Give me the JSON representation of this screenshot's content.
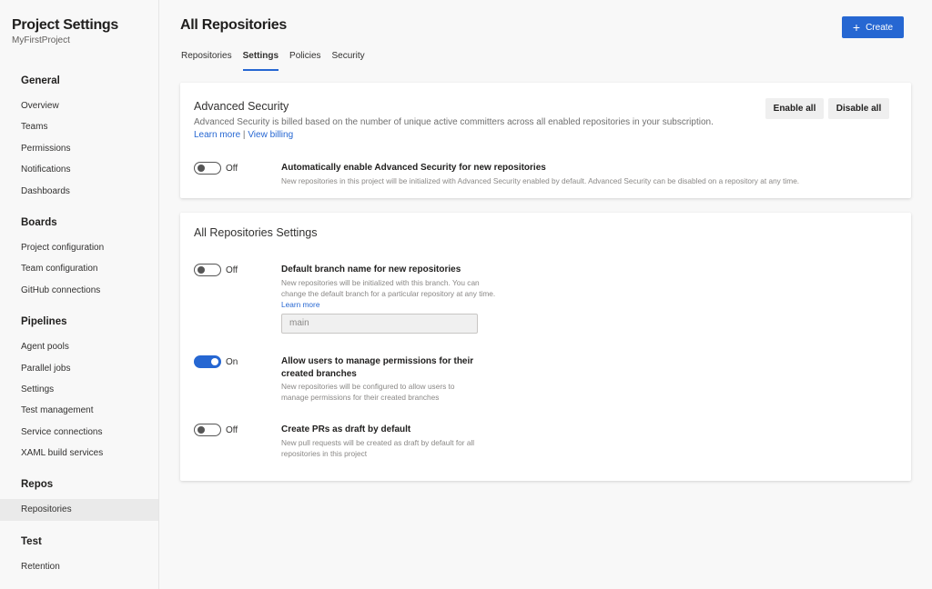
{
  "sidebar": {
    "title": "Project Settings",
    "subtitle": "MyFirstProject",
    "sections": [
      {
        "label": "General",
        "items": [
          "Overview",
          "Teams",
          "Permissions",
          "Notifications",
          "Dashboards"
        ]
      },
      {
        "label": "Boards",
        "items": [
          "Project configuration",
          "Team configuration",
          "GitHub connections"
        ]
      },
      {
        "label": "Pipelines",
        "items": [
          "Agent pools",
          "Parallel jobs",
          "Settings",
          "Test management",
          "Service connections",
          "XAML build services"
        ]
      },
      {
        "label": "Repos",
        "items": [
          "Repositories"
        ]
      },
      {
        "label": "Test",
        "items": [
          "Retention"
        ]
      }
    ],
    "selected": "Repositories"
  },
  "header": {
    "title": "All Repositories",
    "create_label": "Create",
    "create_icon": "plus-icon"
  },
  "tabs": [
    {
      "label": "Repositories"
    },
    {
      "label": "Settings",
      "active": true
    },
    {
      "label": "Policies"
    },
    {
      "label": "Security"
    }
  ],
  "advanced_security": {
    "title": "Advanced Security",
    "description": "Advanced Security is billed based on the number of unique active committers across all enabled repositories in your subscription.",
    "learn_more": "Learn more",
    "separator": "|",
    "view_billing": "View billing",
    "enable_all": "Enable all",
    "disable_all": "Disable all",
    "setting": {
      "state": "Off",
      "on": false,
      "title": "Automatically enable Advanced Security for new repositories",
      "description": "New repositories in this project will be initialized with Advanced Security enabled by default. Advanced Security can be disabled on a repository at any time."
    }
  },
  "all_settings": {
    "title": "All Repositories Settings",
    "default_branch": {
      "state": "Off",
      "on": false,
      "title": "Default branch name for new repositories",
      "description": "New repositories will be initialized with this branch. You can change the default branch for a particular repository at any time.",
      "learn_more": "Learn more",
      "value": "main"
    },
    "manage_permissions": {
      "state": "On",
      "on": true,
      "title": "Allow users to manage permissions for their created branches",
      "description": "New repositories will be configured to allow users to manage permissions for their created branches"
    },
    "draft_prs": {
      "state": "Off",
      "on": false,
      "title": "Create PRs as draft by default",
      "description": "New pull requests will be created as draft by default for all repositories in this project"
    }
  },
  "colors": {
    "accent": "#2667d2"
  }
}
